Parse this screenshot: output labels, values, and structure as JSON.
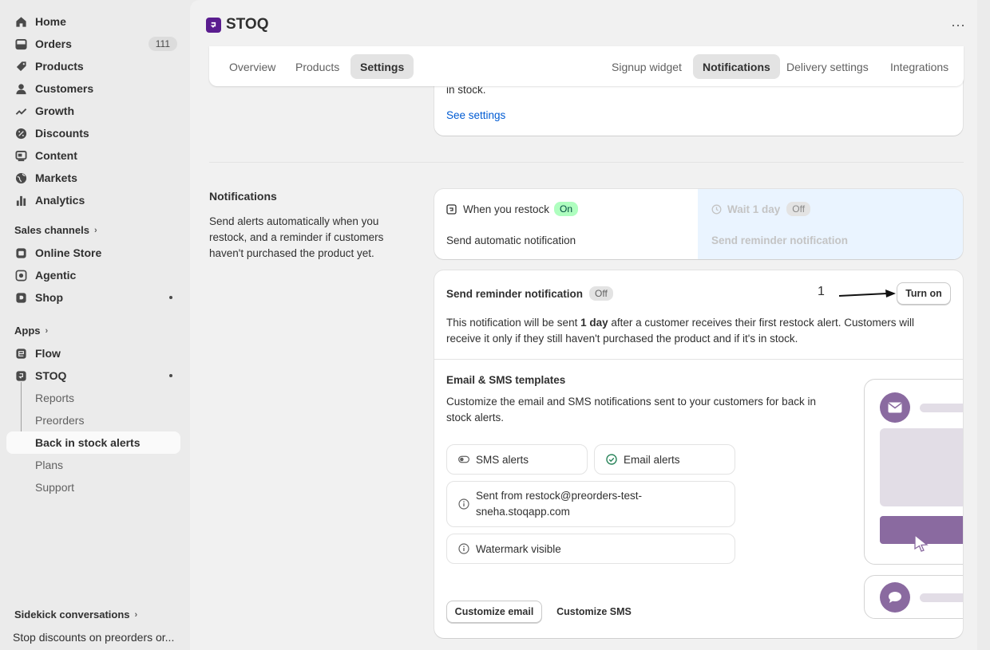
{
  "sidebar": {
    "home": "Home",
    "orders": "Orders",
    "orders_count": "111",
    "products": "Products",
    "customers": "Customers",
    "growth": "Growth",
    "discounts": "Discounts",
    "content": "Content",
    "markets": "Markets",
    "analytics": "Analytics",
    "sales_channels": "Sales channels",
    "online_store": "Online Store",
    "agentic": "Agentic",
    "shop": "Shop",
    "apps": "Apps",
    "flow": "Flow",
    "stoq": "STOQ",
    "reports": "Reports",
    "preorders": "Preorders",
    "back_in_stock": "Back in stock alerts",
    "plans": "Plans",
    "support": "Support",
    "sidekick": "Sidekick conversations",
    "sidekick_item": "Stop discounts on preorders or..."
  },
  "app": {
    "title": "STOQ",
    "logo_color": "#5a1d8f"
  },
  "tabs": {
    "overview": "Overview",
    "products": "Products",
    "settings": "Settings",
    "signup_widget": "Signup widget",
    "notifications": "Notifications",
    "delivery_settings": "Delivery settings",
    "integrations": "Integrations"
  },
  "top_card": {
    "text": "in stock.",
    "link": "See settings"
  },
  "notifications": {
    "title": "Notifications",
    "description": "Send alerts automatically when you restock, and a reminder if customers haven't purchased the product yet.",
    "step1_label": "When you restock",
    "step1_status": "On",
    "step1_sub": "Send automatic notification",
    "step2_label": "Wait 1 day",
    "step2_status": "Off",
    "step2_sub": "Send reminder notification"
  },
  "reminder": {
    "title": "Send reminder notification",
    "status": "Off",
    "annotation": "1",
    "turn_on": "Turn on",
    "desc_pre": "This notification will be sent ",
    "desc_bold": "1 day",
    "desc_post": " after a customer receives their first restock alert. Customers will receive it only if they still haven't purchased the product and if it's in stock."
  },
  "templates": {
    "title": "Email & SMS templates",
    "description": "Customize the email and SMS notifications sent to your customers for back in stock alerts.",
    "sms_alerts": "SMS alerts",
    "email_alerts": "Email alerts",
    "sent_from": "Sent from restock@preorders-test-sneha.stoqapp.com",
    "watermark": "Watermark visible",
    "customize_email": "Customize email",
    "customize_sms": "Customize SMS"
  },
  "colors": {
    "accent_purple": "#8a6aa0",
    "link_blue": "#005bd3",
    "on_green": "#affebf"
  }
}
